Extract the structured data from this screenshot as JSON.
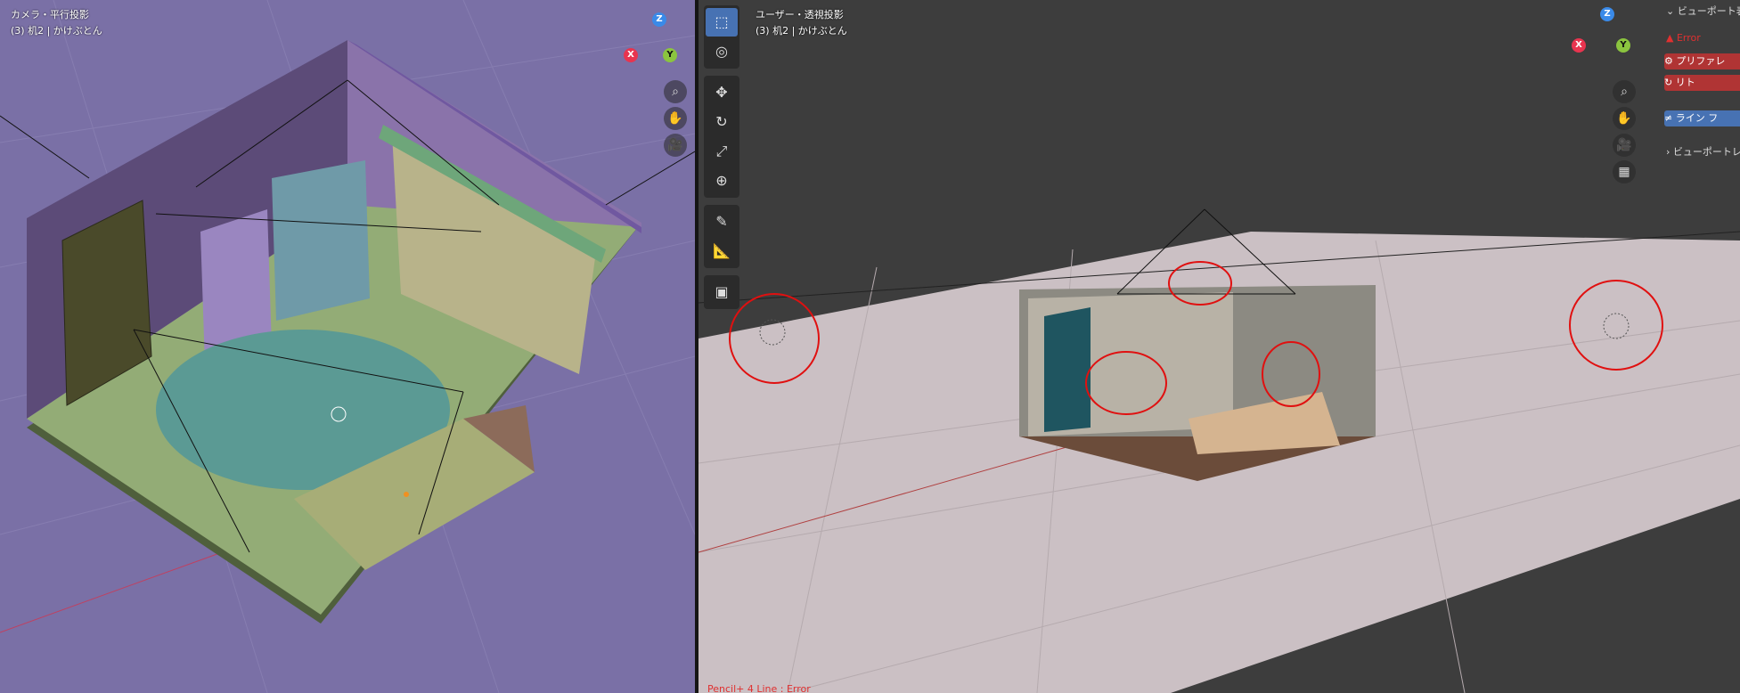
{
  "left_viewport": {
    "view_name": "カメラ・平行投影",
    "collection": "(3) 机2 | かけぶとん",
    "background": "#7a70a6"
  },
  "right_viewport": {
    "view_name": "ユーザー・透視投影",
    "collection": "(3) 机2 | かけぶとん",
    "background": "#3d3d3d",
    "status": "Pencil+ 4 Line : Error"
  },
  "gizmo_axes": {
    "x": "X",
    "y": "Y",
    "z": "Z"
  },
  "axis_colors": {
    "x": "#e8344f",
    "y": "#8bc43f",
    "z": "#3a8ae8"
  },
  "nav_icons": [
    "zoom-icon",
    "hand-pan-icon",
    "camera-icon",
    "grid-icon"
  ],
  "toolbar_tools": [
    "select-box",
    "cursor",
    "move",
    "rotate",
    "scale",
    "transform",
    "annotate",
    "measure",
    "add-cube"
  ],
  "n_panel": {
    "viewport_display": "ビューポート表",
    "error_label": "Error",
    "preferences_button": "プリファレ",
    "refresh_button": "リト",
    "line_button": "ライン フ",
    "viewport_render": "ビューポートレ"
  },
  "colors": {
    "accent": "#4772b3",
    "error": "#e03030",
    "error_button": "#b03434"
  }
}
